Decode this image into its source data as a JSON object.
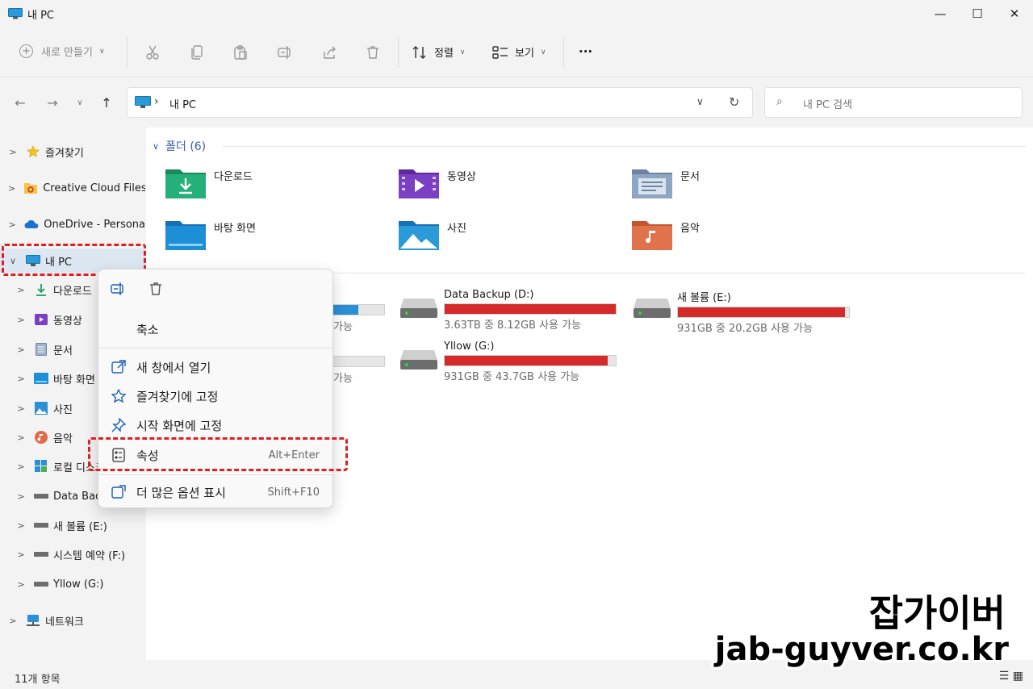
{
  "window": {
    "title": "내 PC",
    "minimize": "—",
    "maximize": "☐",
    "close": "✕"
  },
  "toolbar": {
    "new_label": "새로 만들기",
    "sort_label": "정렬",
    "view_label": "보기",
    "more_label": "···"
  },
  "address": {
    "separator": "›",
    "crumb": "내 PC",
    "dropdown": "∨",
    "refresh": "↻",
    "search_placeholder": "내 PC 검색"
  },
  "sidebar": {
    "items": [
      {
        "label": "즐겨찾기",
        "toggle": ">"
      },
      {
        "label": "Creative Cloud Files",
        "toggle": ">"
      },
      {
        "label": "OneDrive - Persona",
        "toggle": ">"
      },
      {
        "label": "내 PC",
        "toggle": "∨"
      },
      {
        "label": "다운로드",
        "toggle": ">"
      },
      {
        "label": "동영상",
        "toggle": ">"
      },
      {
        "label": "문서",
        "toggle": ">"
      },
      {
        "label": "바탕 화면",
        "toggle": ">"
      },
      {
        "label": "사진",
        "toggle": ">"
      },
      {
        "label": "음악",
        "toggle": ">"
      },
      {
        "label": "로컬 디스크",
        "toggle": ">"
      },
      {
        "label": "Data Backup (D:)",
        "toggle": ">"
      },
      {
        "label": "새 볼륨 (E:)",
        "toggle": ">"
      },
      {
        "label": "시스템 예약 (F:)",
        "toggle": ">"
      },
      {
        "label": "Yllow (G:)",
        "toggle": ">"
      },
      {
        "label": "네트워크",
        "toggle": ">"
      }
    ]
  },
  "folders_group": {
    "header": "폴더 (6)",
    "folders": [
      "다운로드",
      "동영상",
      "문서",
      "바탕 화면",
      "사진",
      "음악"
    ]
  },
  "drives": [
    {
      "name": "Data Backup (D:)",
      "free_text": "3.63TB 중 8.12GB 사용 가능",
      "used_fraction": 0.998
    },
    {
      "name": "새 볼륨 (E:)",
      "free_text": "931GB 중 20.2GB 사용 가능",
      "used_fraction": 0.978
    },
    {
      "name": "Yllow (G:)",
      "free_text": "931GB 중 43.7GB 사용 가능",
      "used_fraction": 0.953
    }
  ],
  "partial": {
    "free_1": "가능",
    "free_2": "가능"
  },
  "context_menu": {
    "collapse": "축소",
    "open_new_window": "새 창에서 열기",
    "pin_quick_access": "즐겨찾기에 고정",
    "pin_start": "시작 화면에 고정",
    "properties": "속성",
    "properties_shortcut": "Alt+Enter",
    "more_options": "더 많은 옵션 표시",
    "more_options_shortcut": "Shift+F10"
  },
  "status": {
    "item_count": "11개 항목",
    "views": "☰ ▦"
  },
  "watermark": {
    "line1": "잡가이버",
    "line2": "jab-guyver.co.kr"
  },
  "colors": {
    "drive_full": "#d42a2a",
    "drive_partial": "#2a8fd4",
    "highlight": "#e02020",
    "selected_bg": "#dde7f2"
  }
}
